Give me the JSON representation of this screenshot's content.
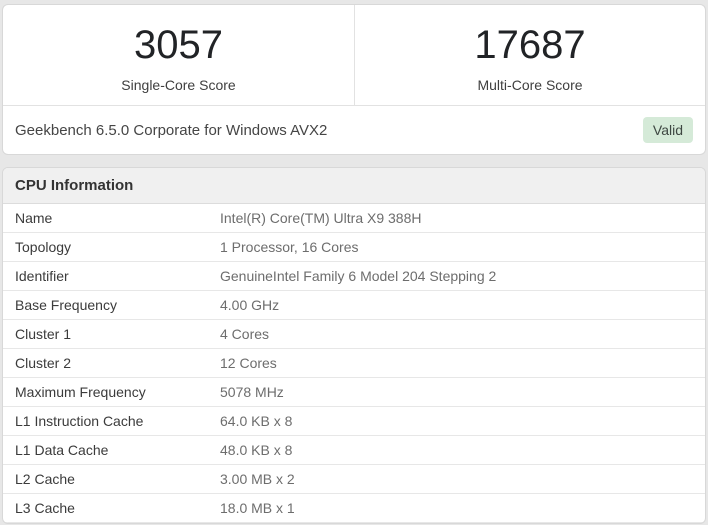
{
  "scores": {
    "single_core": {
      "value": "3057",
      "label": "Single-Core Score"
    },
    "multi_core": {
      "value": "17687",
      "label": "Multi-Core Score"
    }
  },
  "result_bar": {
    "title": "Geekbench 6.5.0 Corporate for Windows AVX2",
    "badge": "Valid"
  },
  "cpu_information": {
    "header": "CPU Information",
    "rows": [
      {
        "label": "Name",
        "value": "Intel(R) Core(TM) Ultra X9 388H"
      },
      {
        "label": "Topology",
        "value": "1 Processor, 16 Cores"
      },
      {
        "label": "Identifier",
        "value": "GenuineIntel Family 6 Model 204 Stepping 2"
      },
      {
        "label": "Base Frequency",
        "value": "4.00 GHz"
      },
      {
        "label": "Cluster 1",
        "value": "4 Cores"
      },
      {
        "label": "Cluster 2",
        "value": "12 Cores"
      },
      {
        "label": "Maximum Frequency",
        "value": "5078 MHz"
      },
      {
        "label": "L1 Instruction Cache",
        "value": "64.0 KB x 8"
      },
      {
        "label": "L1 Data Cache",
        "value": "48.0 KB x 8"
      },
      {
        "label": "L2 Cache",
        "value": "3.00 MB x 2"
      },
      {
        "label": "L3 Cache",
        "value": "18.0 MB x 1"
      }
    ]
  },
  "colors": {
    "badge_bg": "#d5ead8",
    "badge_text": "#3e4742"
  }
}
